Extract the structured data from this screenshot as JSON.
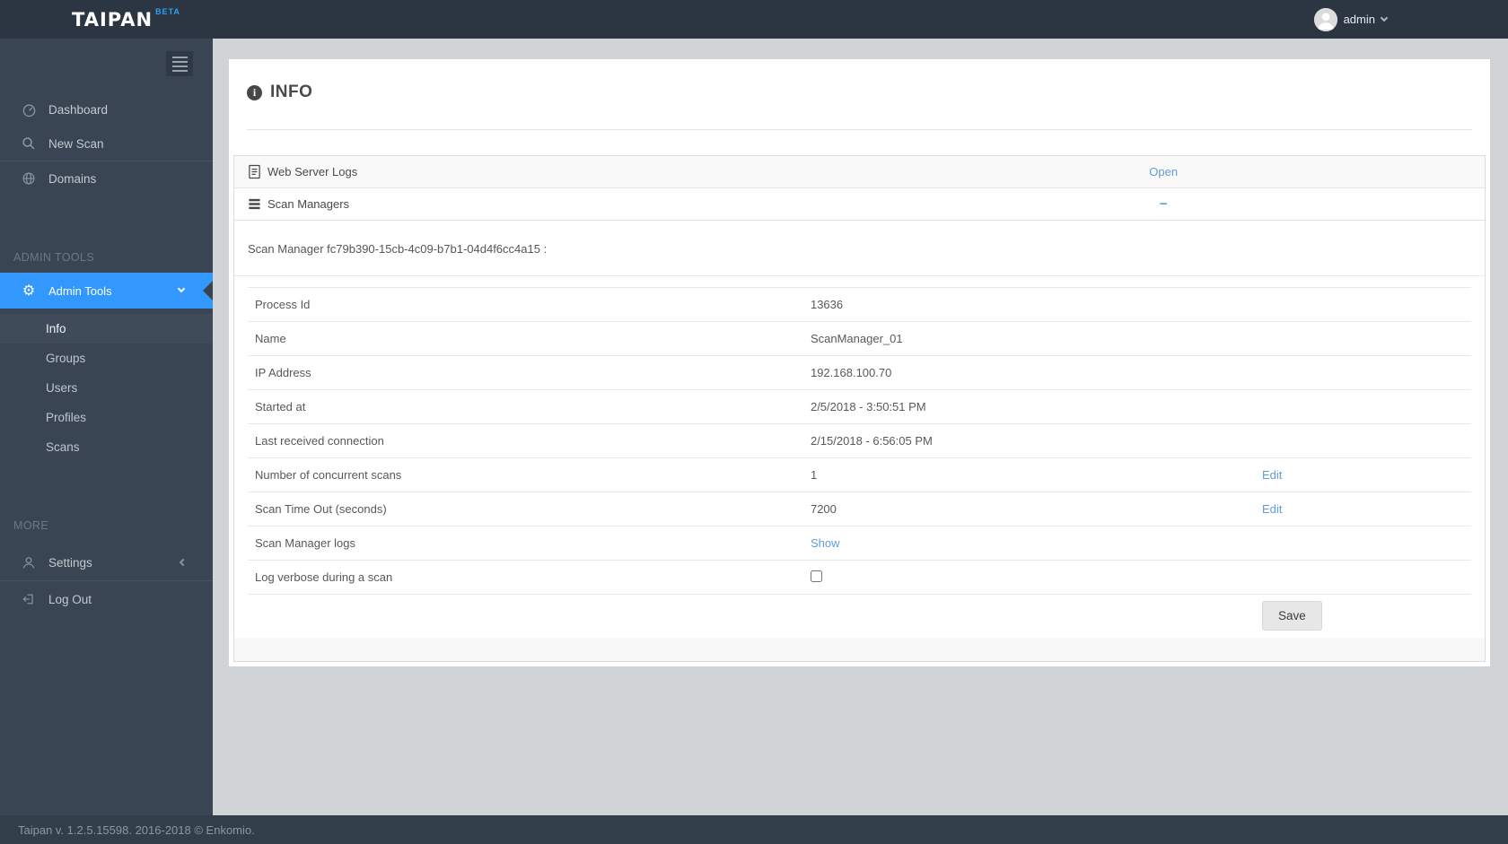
{
  "topbar": {
    "logo": "TAIPAN",
    "beta_badge": "BETA",
    "username": "admin"
  },
  "sidebar": {
    "items": [
      {
        "label": "Dashboard",
        "icon": "dashboard-icon"
      },
      {
        "label": "New Scan",
        "icon": "search-icon"
      },
      {
        "label": "Domains",
        "icon": "globe-icon"
      }
    ],
    "admin_section_label": "ADMIN TOOLS",
    "admin_tools": {
      "label": "Admin Tools",
      "icon": "gear-icon"
    },
    "submenu": [
      {
        "label": "Info",
        "active": true
      },
      {
        "label": "Groups",
        "active": false
      },
      {
        "label": "Users",
        "active": false
      },
      {
        "label": "Profiles",
        "active": false
      },
      {
        "label": "Scans",
        "active": false
      }
    ],
    "more_section_label": "MORE",
    "settings_label": "Settings",
    "logout_label": "Log Out"
  },
  "main": {
    "title": "INFO",
    "panels": [
      {
        "label": "Web Server Logs",
        "icon": "file-text-icon",
        "action": "Open"
      },
      {
        "label": "Scan Managers",
        "icon": "list-icon",
        "action": "−"
      }
    ],
    "scan_manager_heading": "Scan Manager fc79b390-15cb-4c09-b7b1-04d4f6cc4a15 :",
    "details": [
      {
        "label": "Process Id",
        "value": "13636",
        "action": ""
      },
      {
        "label": "Name",
        "value": "ScanManager_01",
        "action": ""
      },
      {
        "label": "IP Address",
        "value": "192.168.100.70",
        "action": ""
      },
      {
        "label": "Started at",
        "value": "2/5/2018 - 3:50:51 PM",
        "action": ""
      },
      {
        "label": "Last received connection",
        "value": "2/15/2018 - 6:56:05 PM",
        "action": ""
      },
      {
        "label": "Number of concurrent scans",
        "value": "1",
        "action": "Edit"
      },
      {
        "label": "Scan Time Out (seconds)",
        "value": "7200",
        "action": "Edit"
      },
      {
        "label": "Scan Manager logs",
        "value": "Show",
        "action": ""
      },
      {
        "label": "Log verbose during a scan",
        "value": "",
        "action": "",
        "checkbox_checked": false
      }
    ],
    "save_label": "Save"
  },
  "footer": {
    "text": "Taipan v. 1.2.5.15598. 2016-2018 © Enkomio."
  },
  "colors": {
    "accent": "#3398fe",
    "link": "#5f9dd8",
    "topbar": "#2b3642",
    "sidebar": "#3a4553",
    "page_background": "#d0d4d7"
  }
}
